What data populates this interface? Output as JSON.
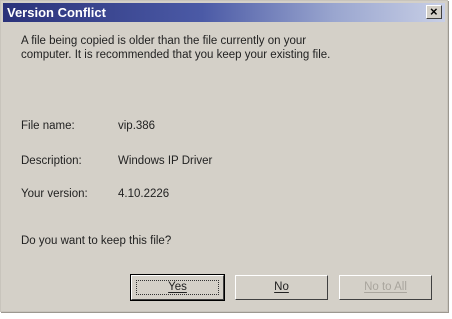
{
  "window": {
    "title": "Version Conflict",
    "close_glyph": "×"
  },
  "message": {
    "line1": "A file being copied is older than the file currently on your",
    "line2": "computer. It is recommended that you keep your existing file."
  },
  "details": [
    {
      "label": "File name:",
      "value": "vip.386"
    },
    {
      "label": "Description:",
      "value": "Windows IP Driver"
    },
    {
      "label": "Your version:",
      "value": "4.10.2226"
    }
  ],
  "question": "Do you want to keep this file?",
  "buttons": {
    "yes": "Yes",
    "no": "No",
    "no_to_all": "No to All"
  }
}
